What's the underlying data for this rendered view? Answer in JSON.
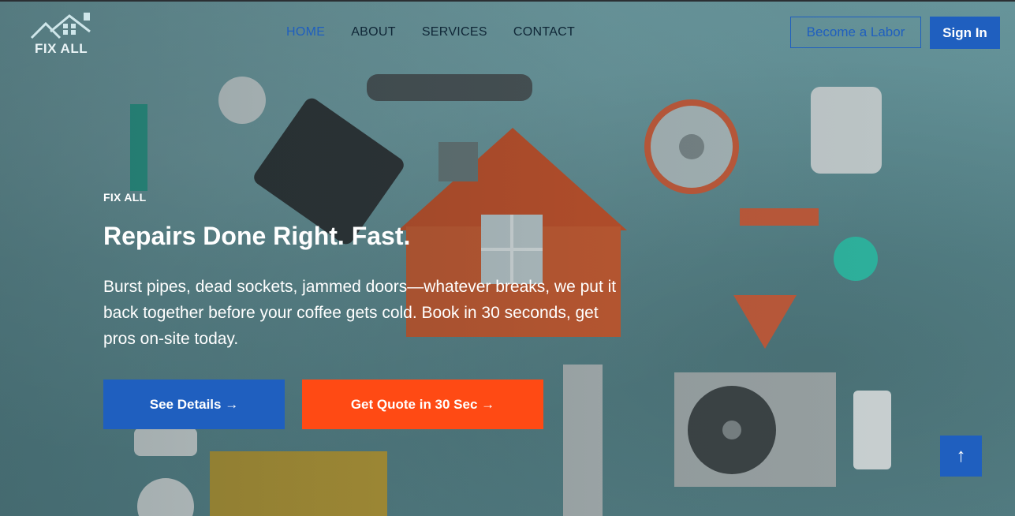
{
  "brand": {
    "name": "FIX ALL",
    "logo_icon": "house-roof-icon"
  },
  "nav": {
    "items": [
      {
        "label": "HOME",
        "active": true
      },
      {
        "label": "ABOUT",
        "active": false
      },
      {
        "label": "SERVICES",
        "active": false
      },
      {
        "label": "CONTACT",
        "active": false
      }
    ]
  },
  "header_actions": {
    "become_labor": "Become a Labor",
    "sign_in": "Sign In"
  },
  "hero": {
    "eyebrow": "FIX ALL",
    "title": "Repairs Done Right. Fast.",
    "description": "Burst pipes, dead sockets, jammed doors—whatever breaks, we put it back together before your coffee gets cold. Book in 30 seconds, get pros on-site today.",
    "primary_cta": "See Details →",
    "secondary_cta": "Get Quote in 30 Sec →"
  },
  "scroll_top": {
    "icon": "arrow-up-icon",
    "glyph": "↑"
  },
  "colors": {
    "primary": "#1f5fbf",
    "accent": "#ff4a14",
    "nav_text": "#0f2636",
    "background": "#5f8d93"
  }
}
